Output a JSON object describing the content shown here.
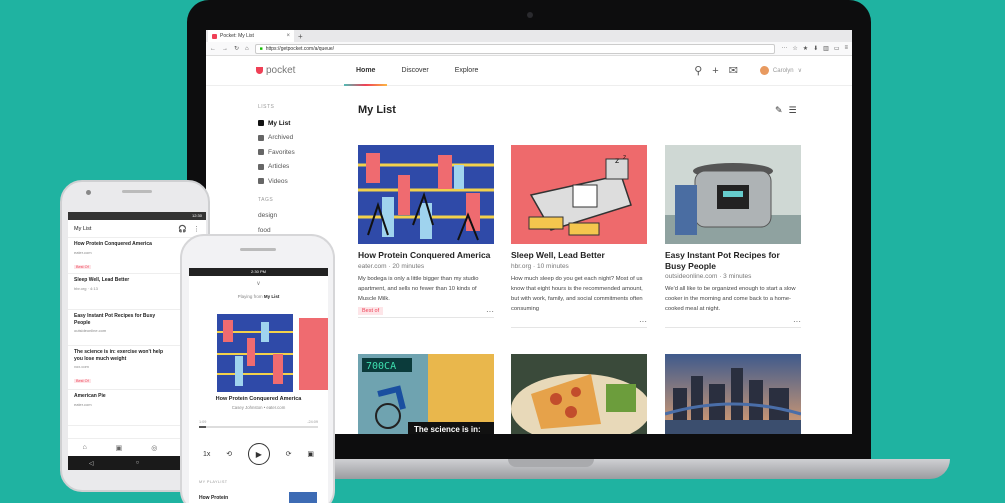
{
  "browser": {
    "tab_title": "Pocket: My List",
    "tab_close": "×",
    "new_tab": "+",
    "url": "https://getpocket.com/a/queue/",
    "nav_icons": [
      "←",
      "→",
      "↻",
      "⌂"
    ],
    "tool_icons": [
      "···",
      "☆",
      "★",
      "⬇",
      "▥",
      "▭",
      "≡"
    ]
  },
  "pocket": {
    "logo_text": "pocket",
    "nav": [
      "Home",
      "Discover",
      "Explore"
    ],
    "user": "Carolyn",
    "user_caret": "∨",
    "header_icons": [
      "⚲",
      "+",
      "✉"
    ],
    "sidebar": {
      "lists_label": "LISTS",
      "items": [
        "My List",
        "Archived",
        "Favorites",
        "Articles",
        "Videos"
      ],
      "tags_label": "TAGS",
      "tags": [
        "design",
        "food"
      ]
    },
    "list_title": "My List",
    "list_tools": [
      "✎",
      "☰"
    ],
    "cards": [
      {
        "title": "How Protein Conquered America",
        "source": "eater.com · 20 minutes",
        "excerpt": "My bodega is only a little bigger than my studio apartment, and sells no fewer than 10 kinds of Muscle Milk.",
        "tag": "Best of",
        "more": "···"
      },
      {
        "title": "Sleep Well, Lead Better",
        "source": "hbr.org · 10 minutes",
        "excerpt": "How much sleep do you get each night? Most of us know that eight hours is the recommended amount, but with work, family, and social commitments often consuming",
        "tag": "",
        "more": "···"
      },
      {
        "title": "Easy Instant Pot Recipes for Busy People",
        "source": "outsideonline.com · 3 minutes",
        "excerpt": "We'd all like to be organized enough to start a slow cooker in the morning and come back to a home-cooked meal at night.",
        "tag": "",
        "more": "···"
      }
    ],
    "card_row2_caption": "The science is in:",
    "card_row2_readout": "700CA"
  },
  "android": {
    "status": "12:30",
    "title": "My List",
    "bar_icons": [
      "🎧",
      "⋮"
    ],
    "rows": [
      {
        "title": "How Protein Conquered America",
        "source": "eater.com",
        "tag": "Best Of"
      },
      {
        "title": "Sleep Well, Lead Better",
        "source": "hbr.org · 4:13",
        "tag": ""
      },
      {
        "title": "Easy Instant Pot Recipes for Busy People",
        "source": "outsideonline.com",
        "tag": ""
      },
      {
        "title": "The science is in: exercise won't help you lose much weight",
        "source": "vox.com",
        "tag": "Best Of"
      },
      {
        "title": "American Pie",
        "source": "eater.com",
        "tag": ""
      }
    ],
    "nav_icons": [
      "⌂",
      "▣",
      "◎",
      "♫"
    ],
    "sys_icons": [
      "◁",
      "○",
      "□"
    ]
  },
  "iphone": {
    "status": "2:30 PM",
    "top_icon": "∨",
    "playing_from_prefix": "Playing from ",
    "playing_from_list": "My List",
    "title": "How Protein Conquered America",
    "author": "Casey Johnston • eater.com",
    "time_elapsed": "1:09",
    "time_remaining": "-24:09",
    "progress": 0.06,
    "speed": "1x",
    "playlist_label": "MY PLAYLIST",
    "next_title": "How Protein",
    "ctrl_icons": [
      "⟲",
      "▶",
      "⟳",
      "▣"
    ]
  },
  "colors": {
    "background": "#1fb3a1",
    "pocket_red": "#ef4056",
    "tag_bg": "#fde5e8"
  }
}
